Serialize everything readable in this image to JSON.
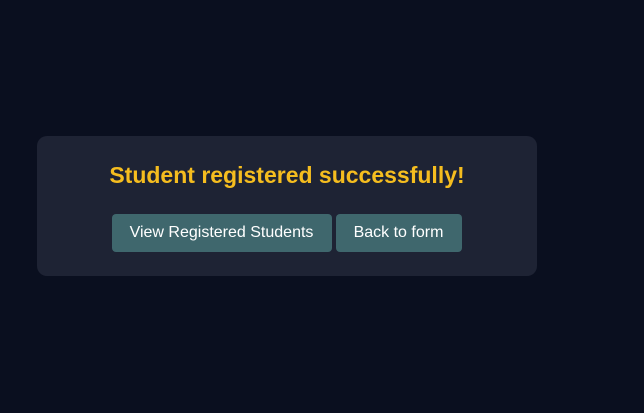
{
  "success": {
    "message": "Student registered successfully!",
    "buttons": {
      "view_students": "View Registered Students",
      "back_to_form": "Back to form"
    }
  },
  "colors": {
    "page_background": "#0a0f1f",
    "card_background": "#1e2334",
    "message_text": "#f5bd1f",
    "button_background": "#3f676d",
    "button_text": "#ffffff"
  }
}
